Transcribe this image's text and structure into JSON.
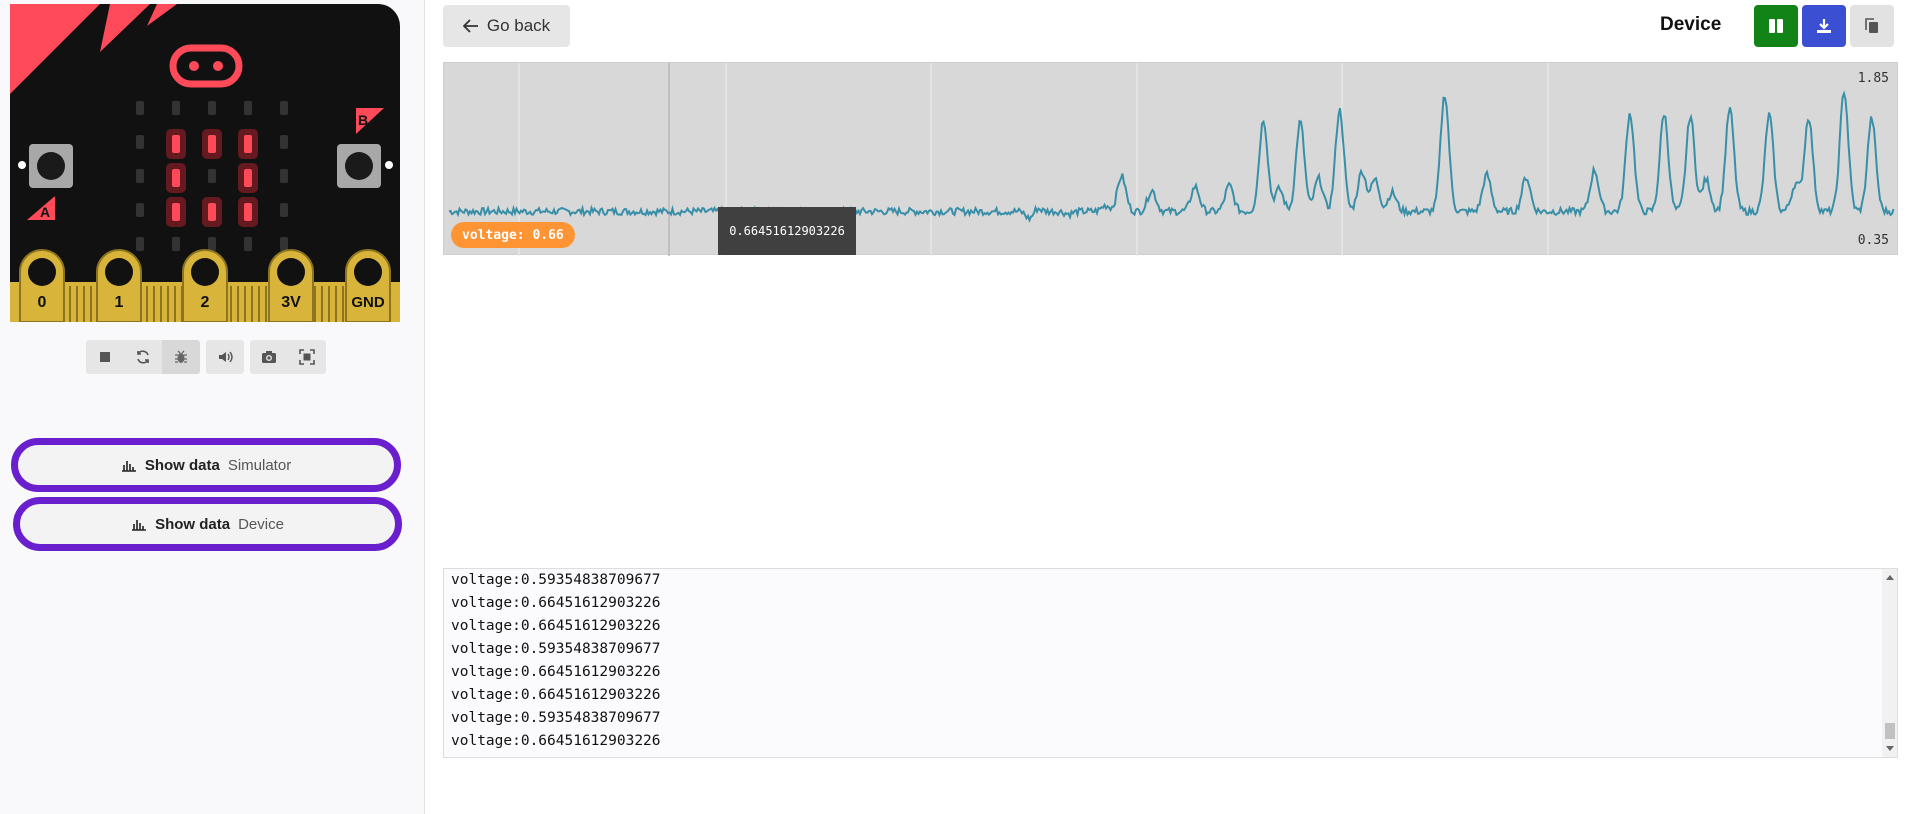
{
  "simulator": {
    "pins": [
      "0",
      "1",
      "2",
      "3V",
      "GND"
    ],
    "button_a": "A",
    "button_b": "B",
    "led_matrix": [
      [
        0,
        0,
        0,
        0,
        0
      ],
      [
        0,
        1,
        1,
        1,
        0
      ],
      [
        0,
        1,
        0,
        1,
        0
      ],
      [
        0,
        1,
        1,
        1,
        0
      ],
      [
        0,
        0,
        0,
        0,
        0
      ]
    ],
    "toolbar_icons": [
      "stop-icon",
      "restart-icon",
      "debug-icon",
      "sound-icon",
      "screenshot-icon",
      "fullscreen-icon"
    ]
  },
  "show_data_sim": {
    "label": "Show data",
    "sub": "Simulator"
  },
  "show_data_dev": {
    "label": "Show data",
    "sub": "Device"
  },
  "header": {
    "go_back": "Go back",
    "device": "Device"
  },
  "colors": {
    "accent_purple": "#6a1fcf",
    "green": "#128317",
    "blue": "#3b4fd3",
    "series": "#3a8fa8",
    "badge": "#ff9434"
  },
  "chart": {
    "ymax_label": "1.85",
    "ymin_label": "0.35",
    "series_badge": "voltage: 0.66",
    "tooltip": "0.66451612903226"
  },
  "chart_data": {
    "type": "line",
    "series": [
      {
        "name": "voltage"
      }
    ],
    "ylim": [
      0.35,
      1.85
    ],
    "baseline": 0.66,
    "peaks": [
      {
        "t": 0.443,
        "v": 0.57
      },
      {
        "t": 0.446,
        "v": 0.72
      },
      {
        "t": 0.472,
        "v": 0.64
      },
      {
        "t": 0.5,
        "v": 0.71
      },
      {
        "t": 0.512,
        "v": 0.96
      },
      {
        "t": 0.535,
        "v": 0.84
      },
      {
        "t": 0.568,
        "v": 0.87
      },
      {
        "t": 0.594,
        "v": 0.88
      },
      {
        "t": 0.62,
        "v": 1.44
      },
      {
        "t": 0.632,
        "v": 0.85
      },
      {
        "t": 0.648,
        "v": 1.42
      },
      {
        "t": 0.662,
        "v": 0.94
      },
      {
        "t": 0.678,
        "v": 1.52
      },
      {
        "t": 0.695,
        "v": 1.0
      },
      {
        "t": 0.705,
        "v": 0.93
      },
      {
        "t": 0.718,
        "v": 0.82
      },
      {
        "t": 0.758,
        "v": 1.65
      },
      {
        "t": 0.79,
        "v": 0.97
      },
      {
        "t": 0.82,
        "v": 0.95
      },
      {
        "t": 0.872,
        "v": 1.01
      },
      {
        "t": 0.899,
        "v": 1.49
      },
      {
        "t": 0.925,
        "v": 1.49
      },
      {
        "t": 0.945,
        "v": 1.47
      },
      {
        "t": 0.957,
        "v": 0.93
      },
      {
        "t": 0.975,
        "v": 1.53
      },
      {
        "t": 1.005,
        "v": 1.48
      },
      {
        "t": 1.025,
        "v": 0.89
      },
      {
        "t": 1.035,
        "v": 1.46
      },
      {
        "t": 1.062,
        "v": 1.68
      },
      {
        "t": 1.083,
        "v": 1.45
      }
    ]
  },
  "console": {
    "lines": [
      "voltage:0.59354838709677",
      "voltage:0.66451612903226",
      "voltage:0.66451612903226",
      "voltage:0.59354838709677",
      "voltage:0.66451612903226",
      "voltage:0.66451612903226",
      "voltage:0.59354838709677",
      "voltage:0.66451612903226"
    ]
  }
}
